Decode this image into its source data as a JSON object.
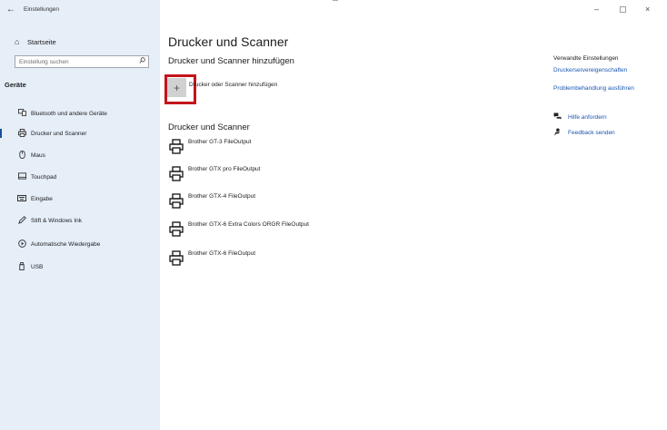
{
  "window": {
    "app_title": "Einstellungen",
    "back_glyph": "←",
    "controls": {
      "minimize": "–",
      "maximize": "▢",
      "close": "×"
    }
  },
  "sidebar": {
    "home_label": "Startseite",
    "home_icon": "home-icon",
    "search_placeholder": "Einstellung suchen",
    "group_title": "Geräte",
    "active_color": "#1a4f9c",
    "items": [
      {
        "label": "Bluetooth und andere Geräte",
        "icon": "bluetooth-devices-icon",
        "active": false
      },
      {
        "label": "Drucker und Scanner",
        "icon": "printer-icon",
        "active": true
      },
      {
        "label": "Maus",
        "icon": "mouse-icon",
        "active": false
      },
      {
        "label": "Touchpad",
        "icon": "touchpad-icon",
        "active": false
      },
      {
        "label": "Eingabe",
        "icon": "keyboard-icon",
        "active": false
      },
      {
        "label": "Stift & Windows Ink",
        "icon": "pen-icon",
        "active": false
      },
      {
        "label": "Automatische Wiedergabe",
        "icon": "autoplay-icon",
        "active": false
      },
      {
        "label": "USB",
        "icon": "usb-icon",
        "active": false
      }
    ]
  },
  "main": {
    "title": "Drucker und Scanner",
    "add_section_title": "Drucker und Scanner hinzufügen",
    "add_button_label": "Drucker oder Scanner hinzufügen",
    "add_glyph": "+",
    "highlight_color": "#c4141c",
    "list_section_title": "Drucker und Scanner",
    "printers": [
      "Brother GT-3 FileOutput",
      "Brother GTX pro FileOutput",
      "Brother GTX-4 FileOutput",
      "Brother GTX-6 Extra Colors ORGR FileOutput",
      "Brother GTX-6 FileOutput"
    ]
  },
  "related": {
    "title": "Verwandte Einstellungen",
    "links": [
      "Druckerservereigenschaften",
      "Problembehandlung ausführen"
    ],
    "help": [
      {
        "label": "Hilfe anfordern",
        "icon": "help-chat-icon"
      },
      {
        "label": "Feedback senden",
        "icon": "feedback-icon"
      }
    ],
    "link_color": "#1a56b0"
  }
}
